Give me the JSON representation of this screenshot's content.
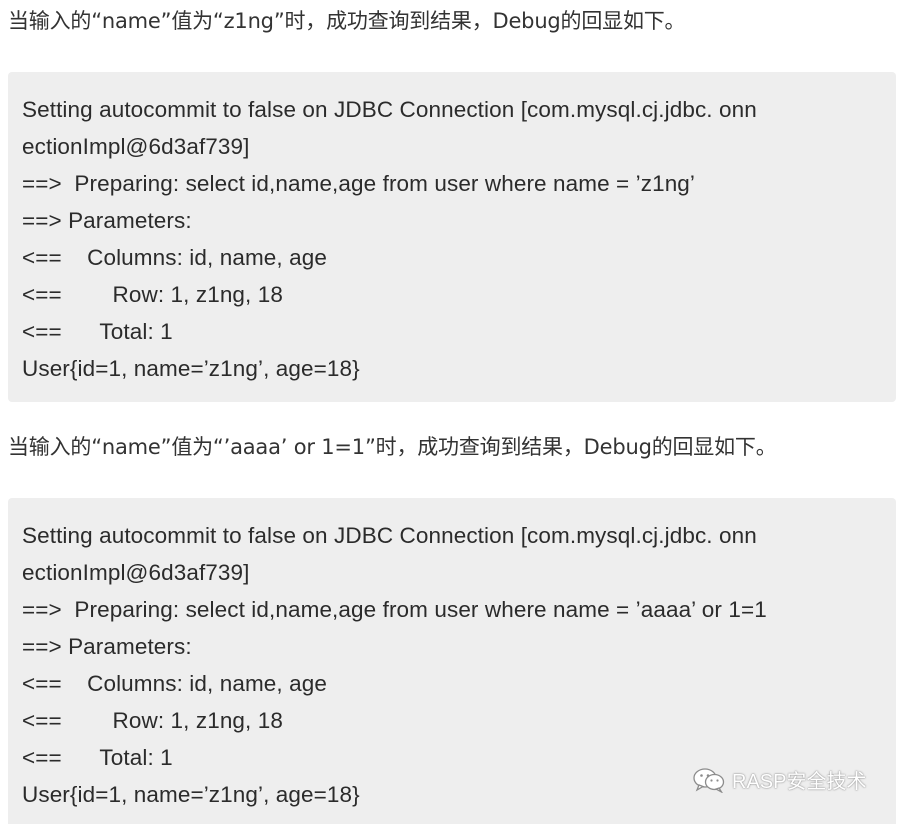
{
  "paragraphs": [
    "当输入的“name”值为“z1ng”时，成功查询到结果，Debug的回显如下。",
    "当输入的“name”值为“’aaaa’ or 1=1”时，成功查询到结果，Debug的回显如下。"
  ],
  "code_blocks": [
    {
      "lines": [
        "Setting autocommit to false on JDBC Connection [com.mysql.cj.jdbc. onn",
        "ectionImpl@6d3af739]",
        "==>  Preparing: select id,name,age from user where name = ’z1ng’",
        "==> Parameters:",
        "<==    Columns: id, name, age",
        "<==        Row: 1, z1ng, 18",
        "<==      Total: 1",
        "User{id=1, name=’z1ng’, age=18}"
      ]
    },
    {
      "lines": [
        "Setting autocommit to false on JDBC Connection [com.mysql.cj.jdbc. onn",
        "ectionImpl@6d3af739]",
        "==>  Preparing: select id,name,age from user where name = ’aaaa’ or 1=1",
        "==> Parameters:",
        "<==    Columns: id, name, age",
        "<==        Row: 1, z1ng, 18",
        "<==      Total: 1",
        "User{id=1, name=’z1ng’, age=18}"
      ]
    }
  ],
  "watermark": {
    "icon": "wechat-icon",
    "text": "RASP安全技术"
  }
}
